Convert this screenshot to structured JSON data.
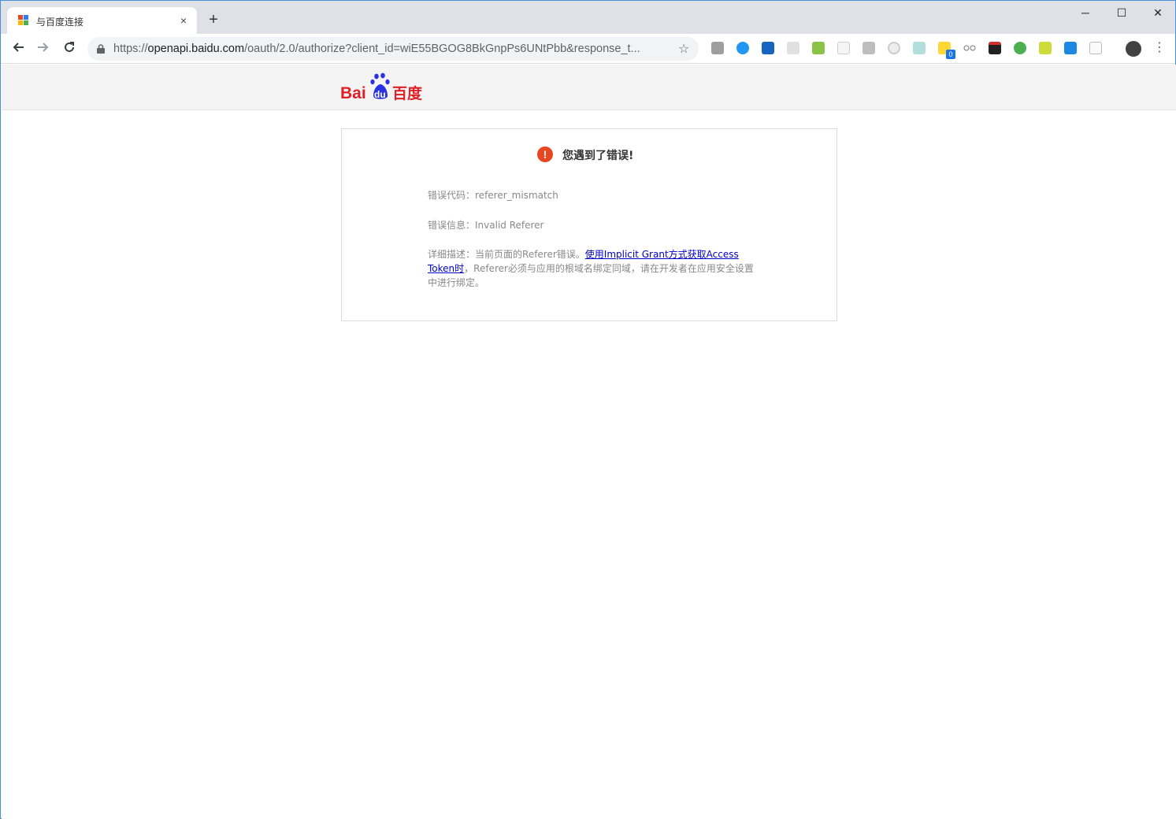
{
  "browser": {
    "tab_title": "与百度连接",
    "tab_close": "×",
    "new_tab": "+",
    "url_scheme": "https://",
    "url_host": "openapi.baidu.com",
    "url_path": "/oauth/2.0/authorize?client_id=wiE55BGOG8BkGnpPs6UNtPbb&response_t...",
    "window_controls": [
      "─",
      "☐",
      "✕"
    ],
    "extension_badge": "0"
  },
  "logo": {
    "text_bai": "Bai",
    "text_du": "du",
    "text_cn": "百度"
  },
  "error": {
    "icon": "!",
    "title": "您遇到了错误!",
    "code_label": "错误代码：",
    "code_value": "referer_mismatch",
    "info_label": "错误信息：",
    "info_value": "Invalid Referer",
    "desc_label": "详细描述：",
    "desc_prefix": "当前页面的Referer错误。",
    "desc_link": "使用Implicit Grant方式获取Access Token时",
    "desc_suffix": "，Referer必须与应用的根域名绑定同域，请在开发者在应用安全设置中进行绑定。"
  }
}
